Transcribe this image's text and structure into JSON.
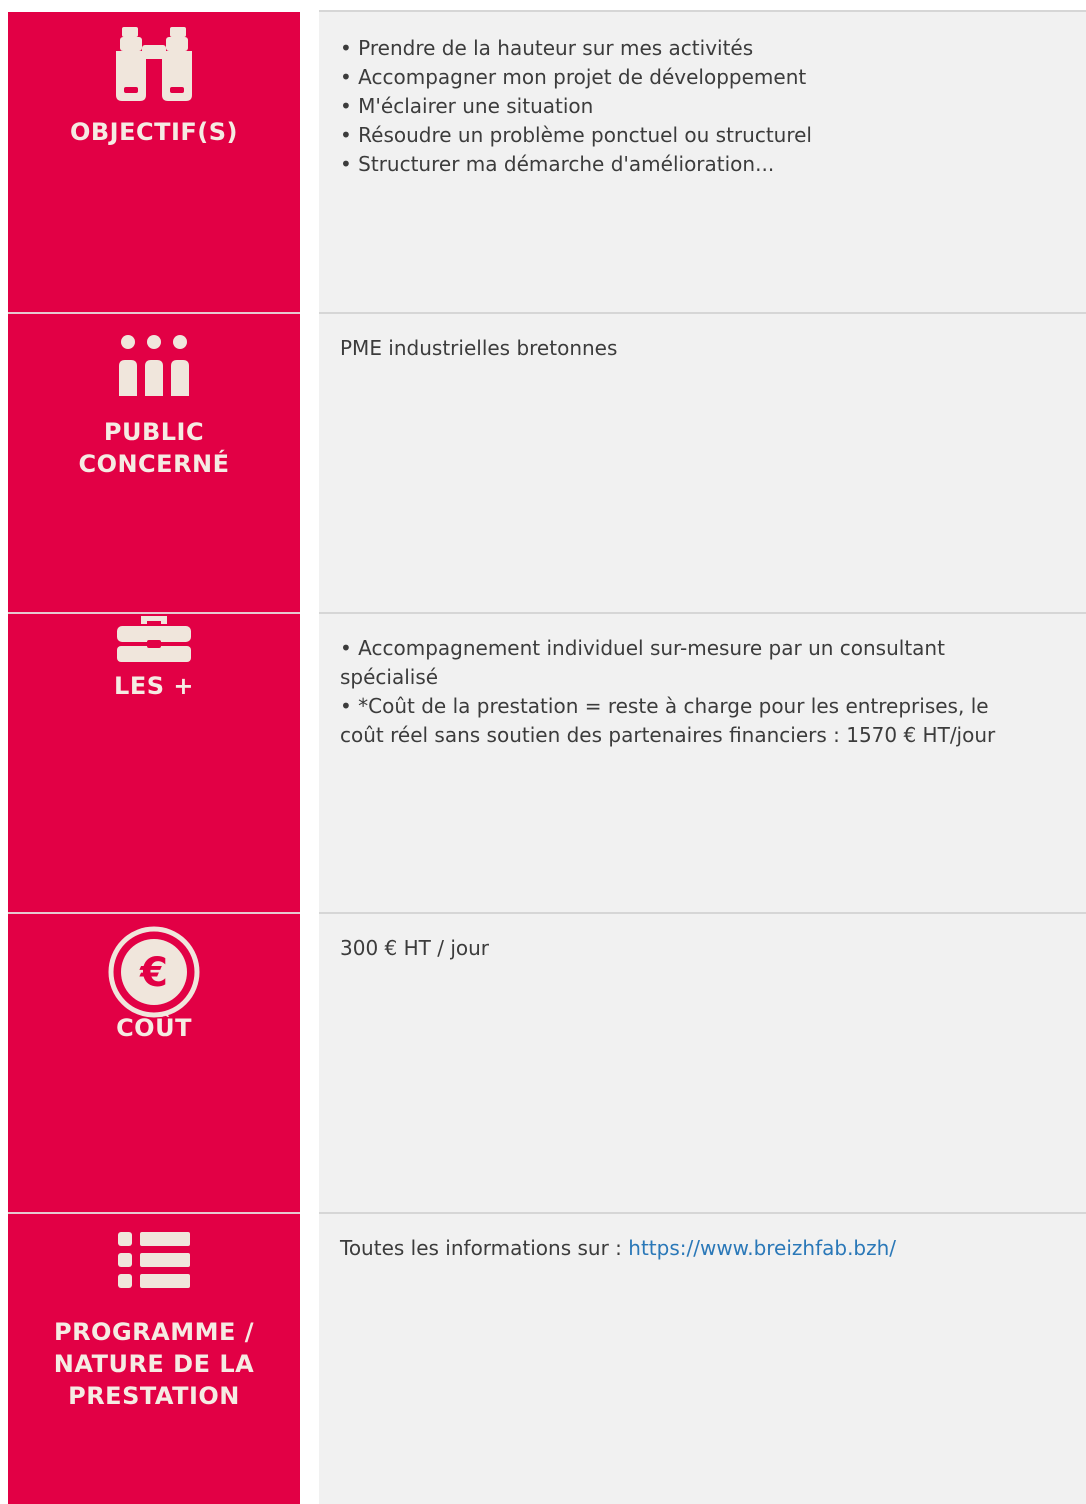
{
  "colors": {
    "accent": "#e20045",
    "icon": "#f0e6dc",
    "panel": "#f1f1f1",
    "text": "#3c3c3c",
    "link": "#2a78b8"
  },
  "rows": [
    {
      "icon": "binoculars-icon",
      "label": "OBJECTIF(S)",
      "items": [
        "• Prendre de la hauteur sur mes activités",
        "• Accompagner mon projet de développement",
        "• M'éclairer une situation",
        "• Résoudre un problème ponctuel ou structurel",
        "• Structurer ma démarche d'amélioration..."
      ]
    },
    {
      "icon": "people-icon",
      "label_lines": [
        "PUBLIC",
        "CONCERNÉ"
      ],
      "text": "PME industrielles bretonnes"
    },
    {
      "icon": "toolbox-icon",
      "label": "LES +",
      "items": [
        "• Accompagnement individuel sur-mesure par un consultant",
        "spécialisé",
        "• *Coût de la prestation = reste à charge pour les entreprises, le",
        "coût réel sans soutien des partenaires financiers : 1570 € HT/jour"
      ]
    },
    {
      "icon": "euro-icon",
      "label": "COÛT",
      "text": "300 € HT / jour"
    },
    {
      "icon": "list-icon",
      "label_lines": [
        "PROGRAMME /",
        "NATURE DE LA",
        "PRESTATION"
      ],
      "text_prefix": "Toutes les informations sur : ",
      "link_text": "https://www.breizhfab.bzh/"
    }
  ]
}
